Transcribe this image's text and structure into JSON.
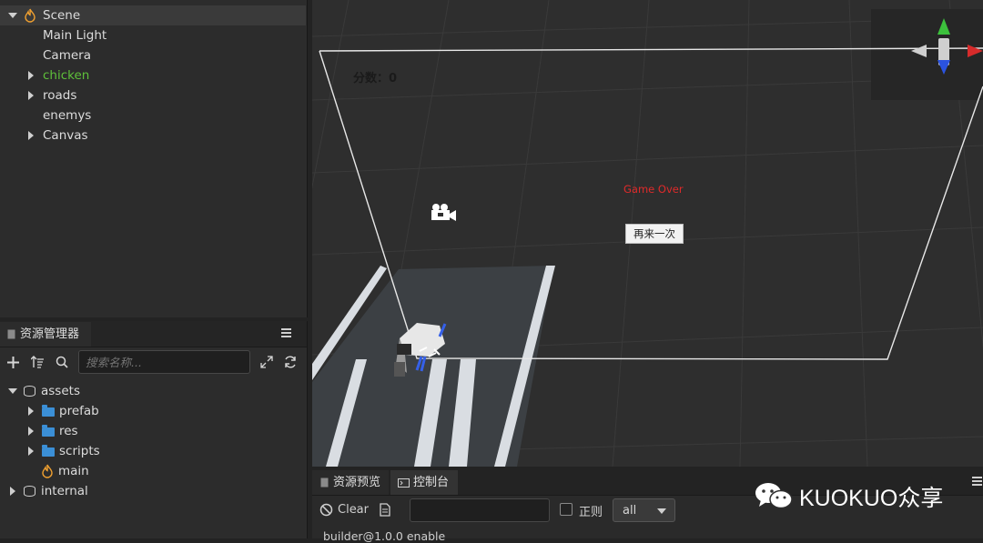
{
  "hierarchy": {
    "items": [
      {
        "label": "Scene",
        "expanded": true
      },
      {
        "label": "Main Light"
      },
      {
        "label": "Camera"
      },
      {
        "label": "chicken",
        "color": "#5ec03a"
      },
      {
        "label": "roads"
      },
      {
        "label": "enemys"
      },
      {
        "label": "Canvas"
      }
    ]
  },
  "assets_panel": {
    "tab_label": "资源管理器",
    "search_placeholder": "搜索名称...",
    "tree": [
      {
        "label": "assets"
      },
      {
        "label": "prefab"
      },
      {
        "label": "res"
      },
      {
        "label": "scripts"
      },
      {
        "label": "main"
      },
      {
        "label": "internal"
      }
    ]
  },
  "scene": {
    "score_label": "分数：0",
    "game_over": "Game Over",
    "retry_button": "再来一次",
    "colors": {
      "game_over": "#e02a2a",
      "gizmo_x": "#d62b2b",
      "gizmo_y": "#3cc13c",
      "gizmo_z": "#2b53e0"
    }
  },
  "console": {
    "tabs": [
      "资源预览",
      "控制台"
    ],
    "clear_label": "Clear",
    "regex_label": "正则",
    "level_value": "all",
    "log_line": "builder@1.0.0 enable"
  },
  "watermark": {
    "text": "KUOKUO众享"
  }
}
